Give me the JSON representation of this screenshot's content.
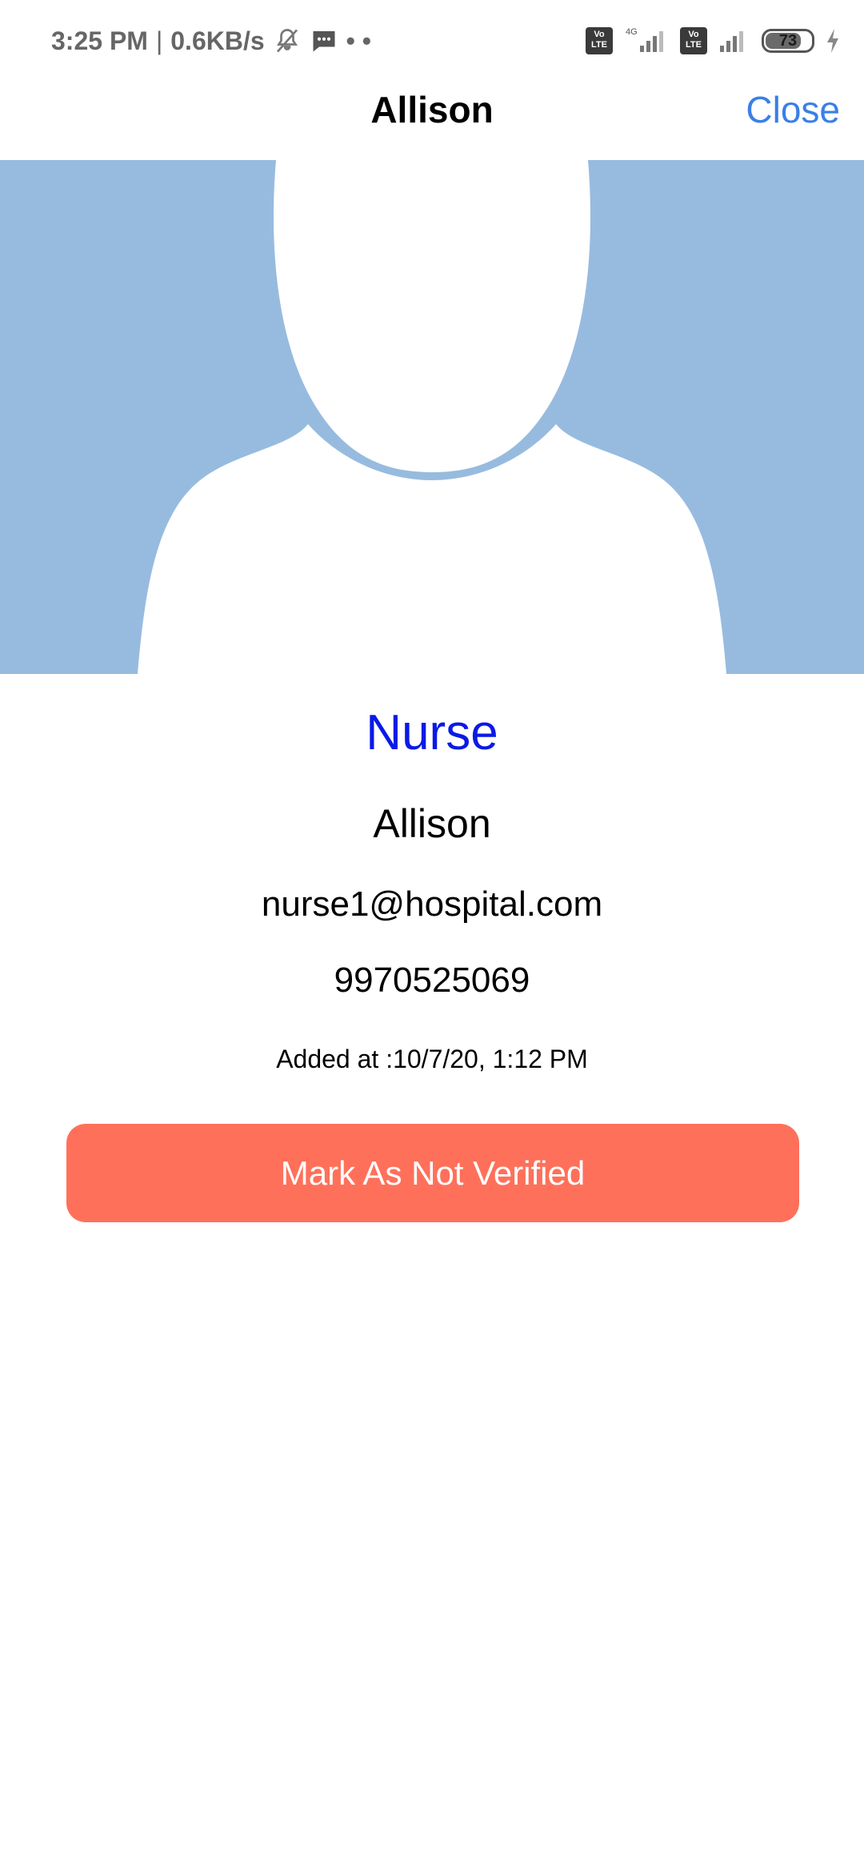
{
  "status_bar": {
    "time": "3:25 PM",
    "separator": "|",
    "net_speed": "0.6KB/s",
    "dots": "• •",
    "network_type": "4G",
    "volte_label": "Vo\nLTE",
    "battery_level": "73",
    "icons": [
      "mute-icon",
      "message-icon",
      "volte-icon",
      "signal-icon",
      "battery-icon",
      "charging-icon"
    ]
  },
  "header": {
    "title": "Allison",
    "close_label": "Close"
  },
  "avatar": {
    "icon": "person-placeholder-icon",
    "background_color": "#97bbdf"
  },
  "profile": {
    "role": "Nurse",
    "name": "Allison",
    "email": "nurse1@hospital.com",
    "phone": "9970525069",
    "added_at": "Added at :10/7/20, 1:12 PM"
  },
  "actions": {
    "verify_button_label": "Mark As Not Verified"
  },
  "colors": {
    "accent_link": "#3a7fe8",
    "role_text": "#0a1ae6",
    "button_bg": "#ff705a"
  }
}
